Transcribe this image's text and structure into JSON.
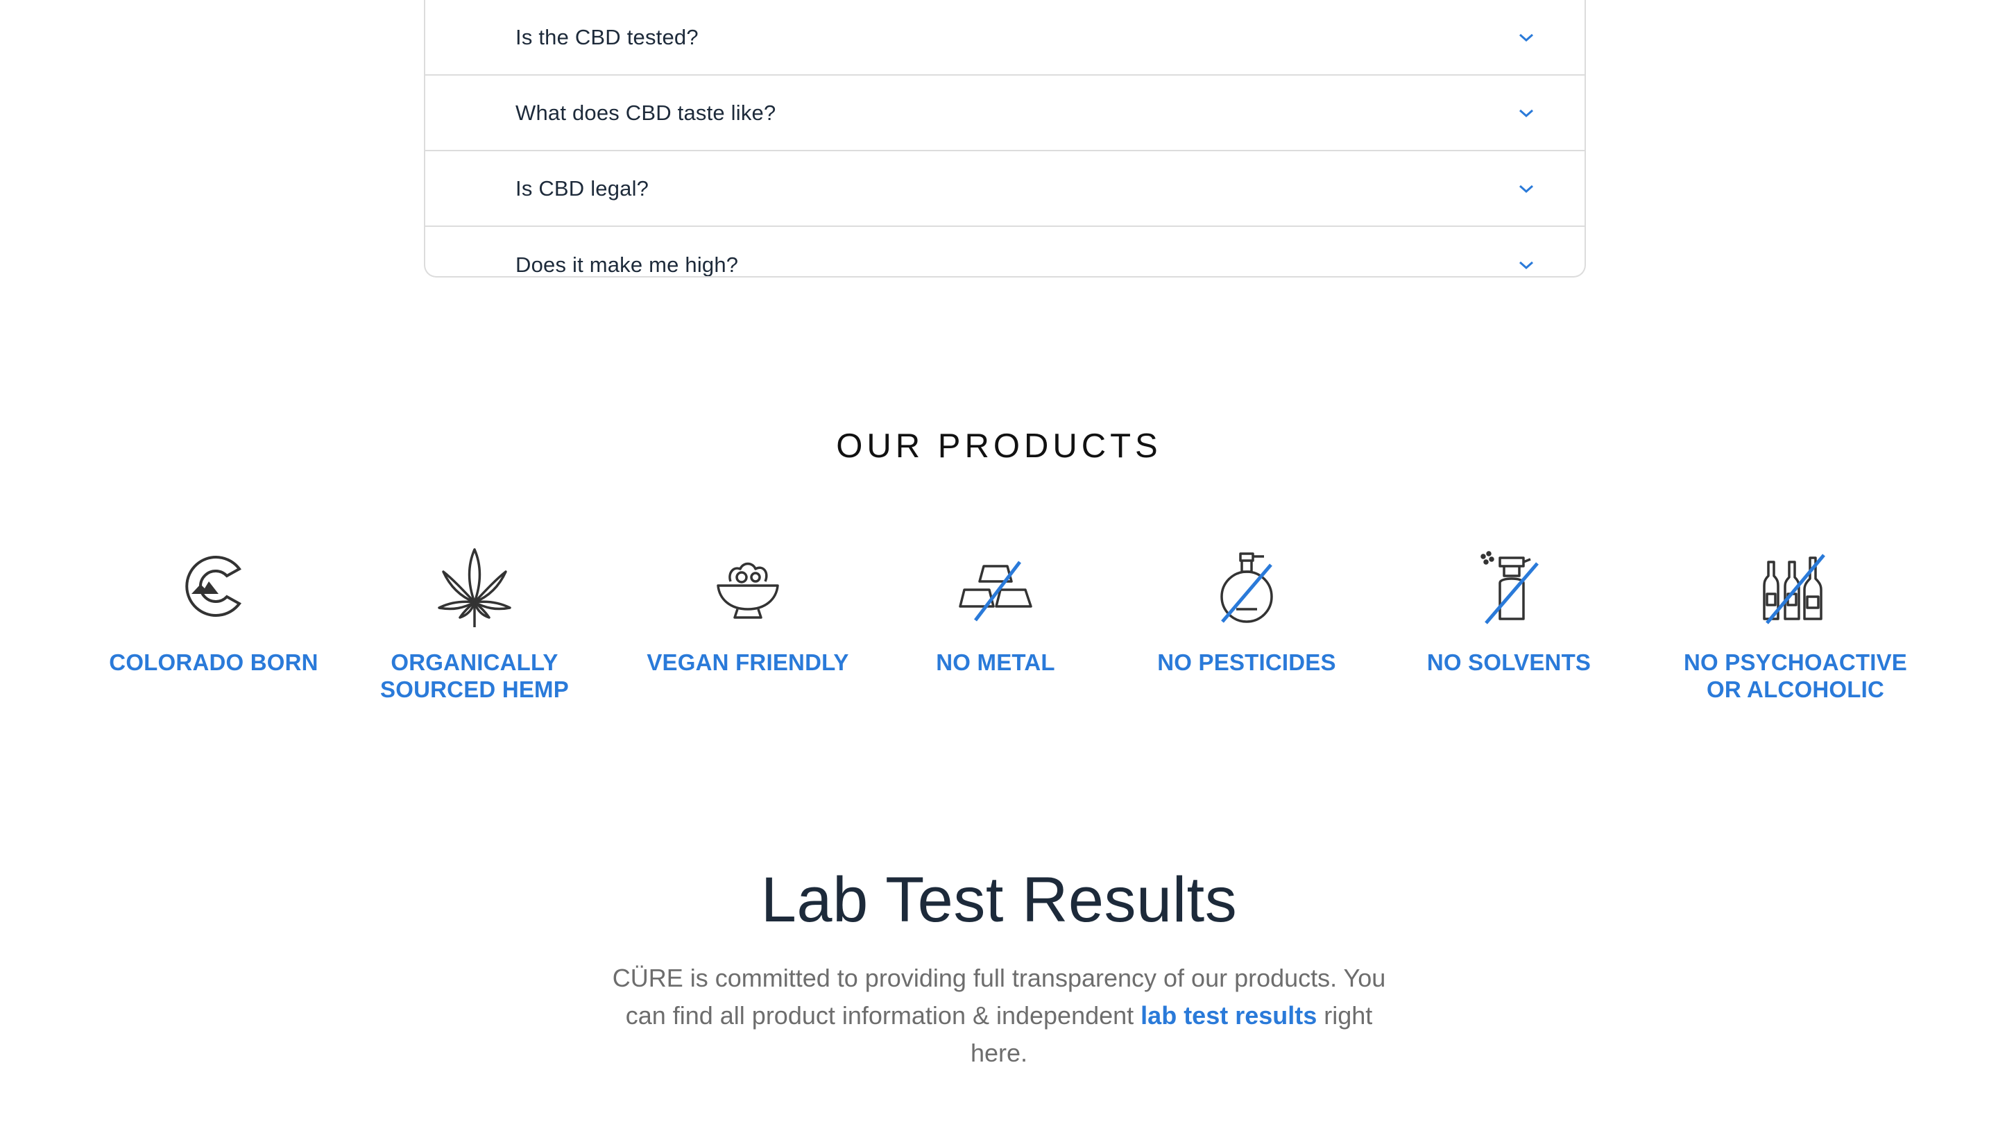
{
  "faq": {
    "items": [
      {
        "question": "Is the CBD tested?"
      },
      {
        "question": "What does CBD taste like?"
      },
      {
        "question": "Is CBD legal?"
      },
      {
        "question": "Does it make me high?"
      }
    ]
  },
  "products": {
    "title": "OUR PRODUCTS",
    "features": [
      {
        "label": "COLORADO BORN",
        "icon": "colorado-flag-icon"
      },
      {
        "label": "ORGANICALLY\nSOURCED HEMP",
        "icon": "hemp-leaf-icon"
      },
      {
        "label": "VEGAN FRIENDLY",
        "icon": "salad-bowl-icon"
      },
      {
        "label": "NO METAL",
        "icon": "no-metal-icon"
      },
      {
        "label": "NO PESTICIDES",
        "icon": "no-pesticides-icon"
      },
      {
        "label": "NO SOLVENTS",
        "icon": "no-solvents-icon"
      },
      {
        "label": "NO PSYCHOACTIVE\nOR ALCOHOLIC",
        "icon": "no-alcohol-icon"
      }
    ],
    "accent_color": "#2a7ad9"
  },
  "lab": {
    "title": "Lab Test Results",
    "text_before": "CÜRE is committed to providing full transparency of our products. You can find all product information & independent ",
    "link_label": "lab test results",
    "text_after": " right here."
  }
}
